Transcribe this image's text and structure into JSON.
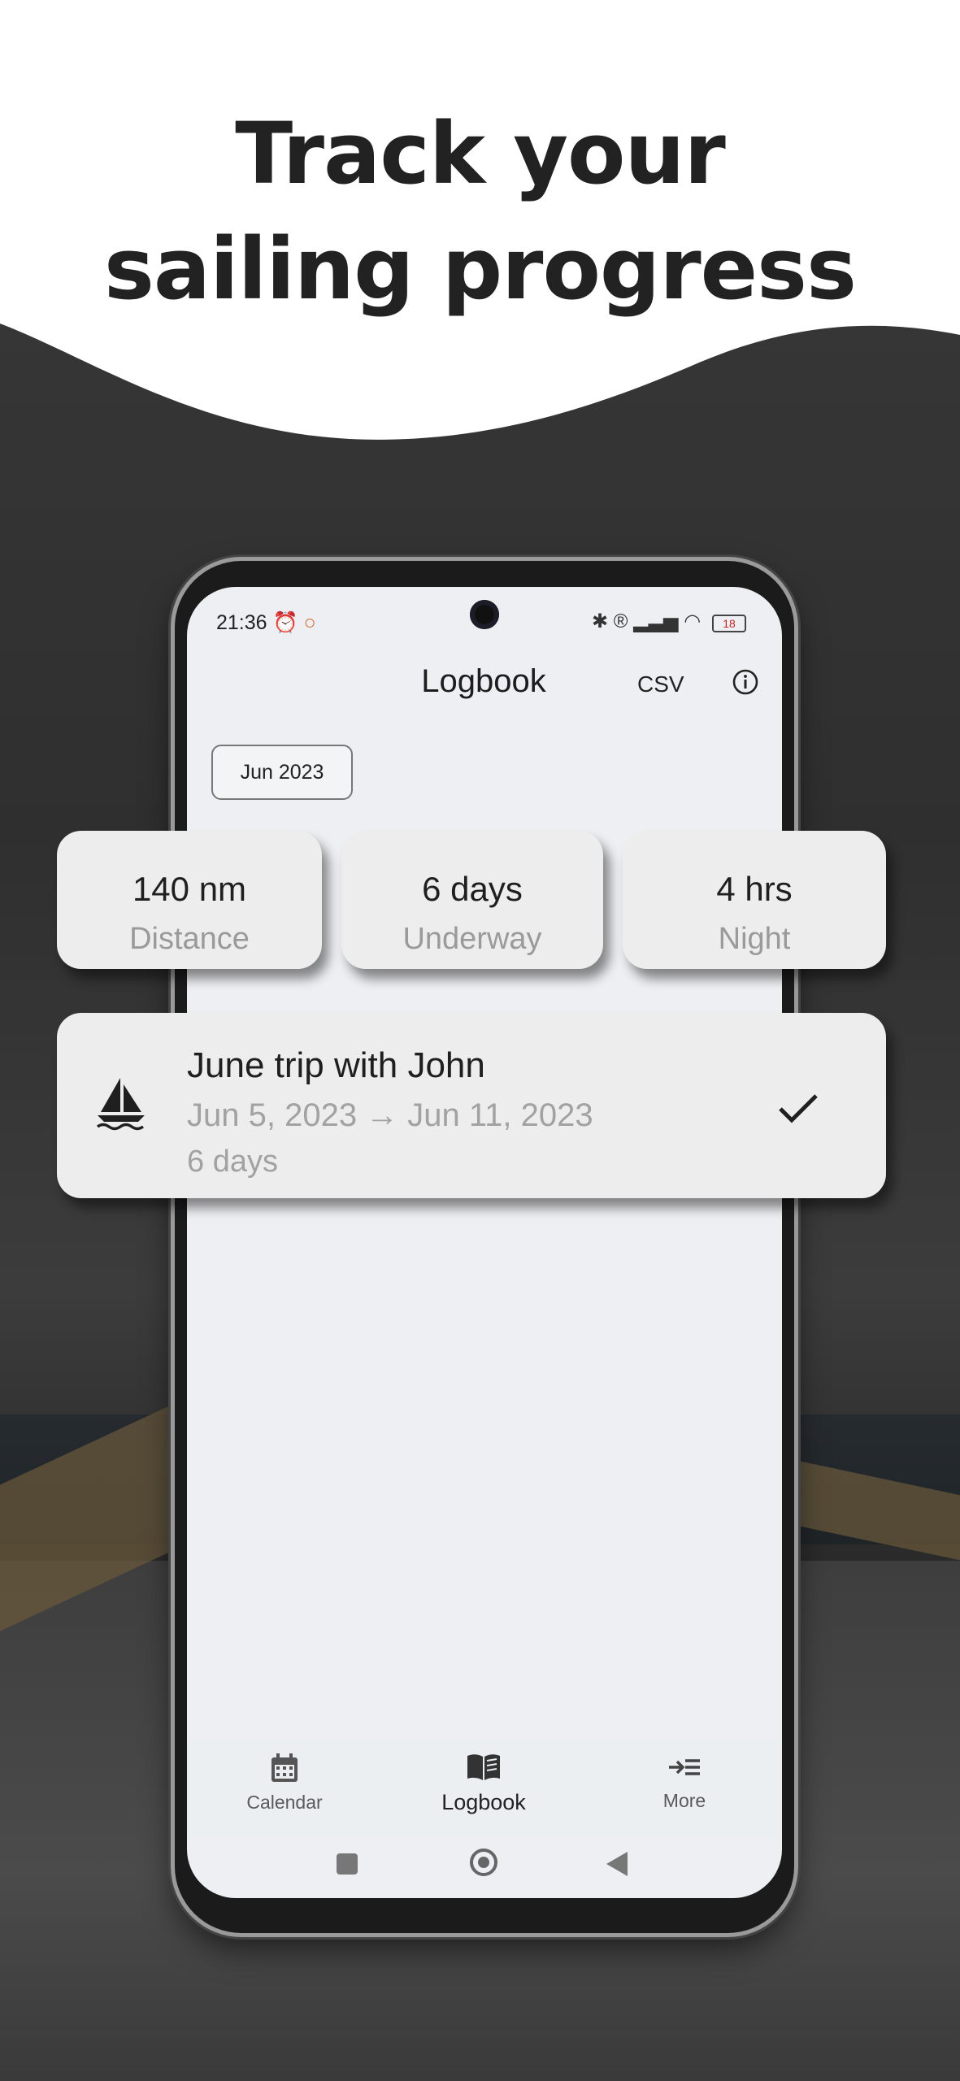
{
  "headline": {
    "line1": "Track your",
    "line2": "sailing progress"
  },
  "status_bar": {
    "time": "21:36",
    "battery": "18"
  },
  "app_bar": {
    "title": "Logbook",
    "csv_label": "CSV"
  },
  "filter_chip": {
    "label": "Jun 2023"
  },
  "stats": [
    {
      "value": "140 nm",
      "label": "Distance"
    },
    {
      "value": "6 days",
      "label": "Underway"
    },
    {
      "value": "4 hrs",
      "label": "Night"
    }
  ],
  "trip": {
    "title": "June trip with John",
    "dates": "Jun 5, 2023 → Jun 11, 2023",
    "duration": "6 days"
  },
  "bottom_nav": {
    "items": [
      {
        "label": "Calendar",
        "icon": "calendar-icon"
      },
      {
        "label": "Logbook",
        "icon": "book-icon",
        "active": true
      },
      {
        "label": "More",
        "icon": "more-menu-icon"
      }
    ]
  },
  "colors": {
    "headline": "#222222",
    "card_bg": "#ededed",
    "muted_text": "#9a9a9a"
  }
}
